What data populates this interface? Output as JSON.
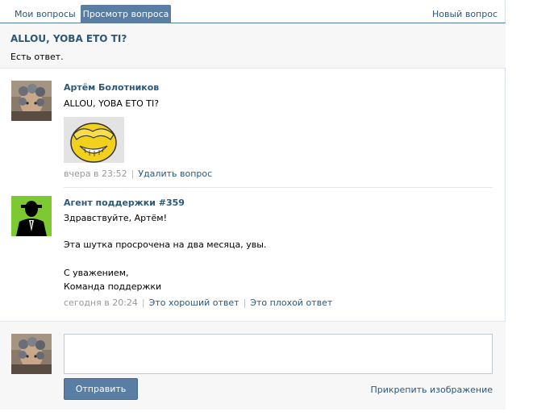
{
  "tabs": {
    "my_questions": "Мои вопросы",
    "view_question": "Просмотр вопроса",
    "new_question": "Новый вопрос"
  },
  "question": {
    "title": "ALLOU, YOBA ETO TI?",
    "status": "Есть ответ."
  },
  "posts": [
    {
      "author": "Артём Болотников",
      "text": "ALLOU, YOBA ETO TI?",
      "time": "вчера в 23:52",
      "actions": [
        "Удалить вопрос"
      ]
    },
    {
      "author": "Агент поддержки #359",
      "lines": [
        "Здравствуйте, Артём!",
        "Эта шутка просрочена на два месяца, увы.",
        "С уважением,",
        "Команда поддержки"
      ],
      "time": "сегодня в 20:24",
      "actions": [
        "Это хороший ответ",
        "Это плохой ответ"
      ]
    }
  ],
  "reply": {
    "textarea_value": "",
    "send_label": "Отправить",
    "attach_label": "Прикрепить изображение"
  },
  "colors": {
    "accent": "#597da3",
    "link": "#2b587a",
    "agent_avatar_bg": "#7cc932"
  }
}
